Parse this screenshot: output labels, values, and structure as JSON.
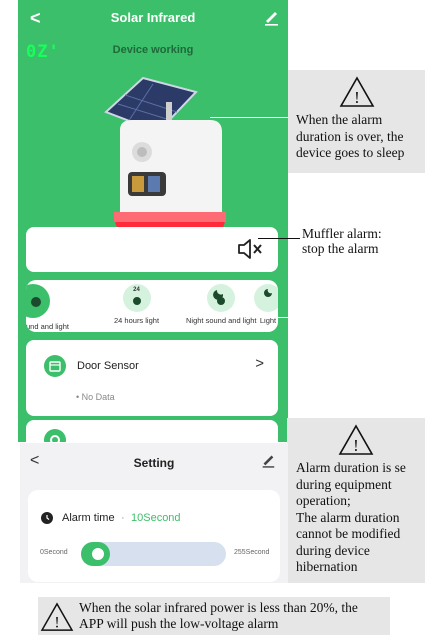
{
  "screen1": {
    "back_glyph": "<",
    "title": "Solar Infrared",
    "status_readout": "0Z'",
    "device_status": "Device working",
    "modes": [
      {
        "label": "und and light"
      },
      {
        "label": "24 hours light",
        "badge": "24"
      },
      {
        "label": "Night sound and light"
      },
      {
        "label": "Light"
      }
    ],
    "sensor": {
      "name": "Door Sensor",
      "arrow": ">",
      "data": "• No Data"
    },
    "accent": "#3cbf6a"
  },
  "callouts": {
    "sleep": [
      "When the alarm",
      "duration is over, the",
      "device goes to sleep"
    ],
    "muffler": [
      "Muffler alarm:",
      "stop the alarm"
    ],
    "alarm_duration": [
      "Alarm duration is se",
      "during equipment",
      "operation;",
      "The alarm duration",
      "cannot be modified",
      "during device",
      "hibernation"
    ]
  },
  "screen2": {
    "back_glyph": "<",
    "title": "Setting",
    "alarm_label": "Alarm time",
    "separator": "·",
    "alarm_value": "10Second",
    "slider_min": "0Second",
    "slider_max": "255Second",
    "slider_fraction": 0.04
  },
  "note": [
    "When the solar infrared power is less than 20%, the",
    "APP will push the low-voltage alarm"
  ]
}
